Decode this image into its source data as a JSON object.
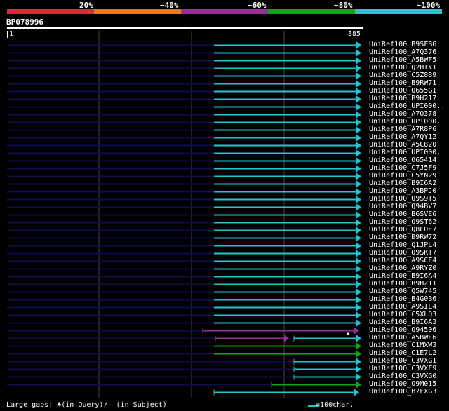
{
  "colors": {
    "background": "#000000",
    "scale_red": "#e8253a",
    "scale_orange": "#e67a25",
    "scale_purple": "#9a2f9a",
    "scale_green": "#1aa01a",
    "scale_cyan": "#25c4d0",
    "unaligned": "#0d0d50",
    "grid": "#444444"
  },
  "legend": {
    "labels": [
      "20%",
      "~40%",
      "~60%",
      "~80%",
      "~100%"
    ]
  },
  "query": {
    "name": "BP078996",
    "start": "1",
    "end": "385"
  },
  "hits": [
    {
      "label": "UniRef100_B9SFB6",
      "color": "cyan"
    },
    {
      "label": "UniRef100_A7Q376",
      "color": "cyan"
    },
    {
      "label": "UniRef100_A5BWF5",
      "color": "cyan"
    },
    {
      "label": "UniRef100_Q2HTY1",
      "color": "cyan"
    },
    {
      "label": "UniRef100_C5Z889",
      "color": "cyan"
    },
    {
      "label": "UniRef100_B9RW71",
      "color": "cyan"
    },
    {
      "label": "UniRef100_Q655G1",
      "color": "cyan"
    },
    {
      "label": "UniRef100_B9H217",
      "color": "cyan"
    },
    {
      "label": "UniRef100_UPI000..",
      "color": "cyan"
    },
    {
      "label": "UniRef100_A7Q378",
      "color": "cyan"
    },
    {
      "label": "UniRef100_UPI000..",
      "color": "cyan"
    },
    {
      "label": "UniRef100_A7R8P6",
      "color": "cyan"
    },
    {
      "label": "UniRef100_A7QY12",
      "color": "cyan"
    },
    {
      "label": "UniRef100_A5C820",
      "color": "cyan"
    },
    {
      "label": "UniRef100_UPI000..",
      "color": "cyan"
    },
    {
      "label": "UniRef100_O65414",
      "color": "cyan"
    },
    {
      "label": "UniRef100_C7J5F9",
      "color": "cyan"
    },
    {
      "label": "UniRef100_C5YN29",
      "color": "cyan"
    },
    {
      "label": "UniRef100_B9I6A2",
      "color": "cyan"
    },
    {
      "label": "UniRef100_A3BPJ0",
      "color": "cyan"
    },
    {
      "label": "UniRef100_Q9S9T5",
      "color": "cyan"
    },
    {
      "label": "UniRef100_Q94BV7",
      "color": "cyan"
    },
    {
      "label": "UniRef100_B6SVE6",
      "color": "cyan"
    },
    {
      "label": "UniRef100_Q9ST62",
      "color": "cyan"
    },
    {
      "label": "UniRef100_Q8LDE7",
      "color": "cyan"
    },
    {
      "label": "UniRef100_B9RW72",
      "color": "cyan"
    },
    {
      "label": "UniRef100_Q1JPL4",
      "color": "cyan"
    },
    {
      "label": "UniRef100_Q9SKT7",
      "color": "cyan"
    },
    {
      "label": "UniRef100_A9SCF4",
      "color": "cyan"
    },
    {
      "label": "UniRef100_A9RYZ0",
      "color": "cyan"
    },
    {
      "label": "UniRef100_B9I6A4",
      "color": "cyan"
    },
    {
      "label": "UniRef100_B9HZ11",
      "color": "cyan"
    },
    {
      "label": "UniRef100_Q5W745",
      "color": "cyan"
    },
    {
      "label": "UniRef100_B4G0B6",
      "color": "cyan"
    },
    {
      "label": "UniRef100_A9SIL4",
      "color": "cyan"
    },
    {
      "label": "UniRef100_C5XLQ3",
      "color": "cyan"
    },
    {
      "label": "UniRef100_B9I6A3",
      "color": "cyan"
    },
    {
      "label": "UniRef100_Q94506",
      "color": "purple"
    },
    {
      "label": "UniRef100_A5BWF6",
      "color": "mixed"
    },
    {
      "label": "UniRef100_C1MXW3",
      "color": "green"
    },
    {
      "label": "UniRef100_C1E7L2",
      "color": "green"
    },
    {
      "label": "UniRef100_C3VXG1",
      "color": "cyan"
    },
    {
      "label": "UniRef100_C3VXF9",
      "color": "cyan"
    },
    {
      "label": "UniRef100_C3VXG0",
      "color": "cyan"
    },
    {
      "label": "UniRef100_Q9M015",
      "color": "green"
    },
    {
      "label": "UniRef100_B7FXG3",
      "color": "cyan"
    }
  ],
  "footer": {
    "gaps_note": "Large gaps: ♣(in Query)/— (in Subject)",
    "scale_note": "  =100char."
  }
}
